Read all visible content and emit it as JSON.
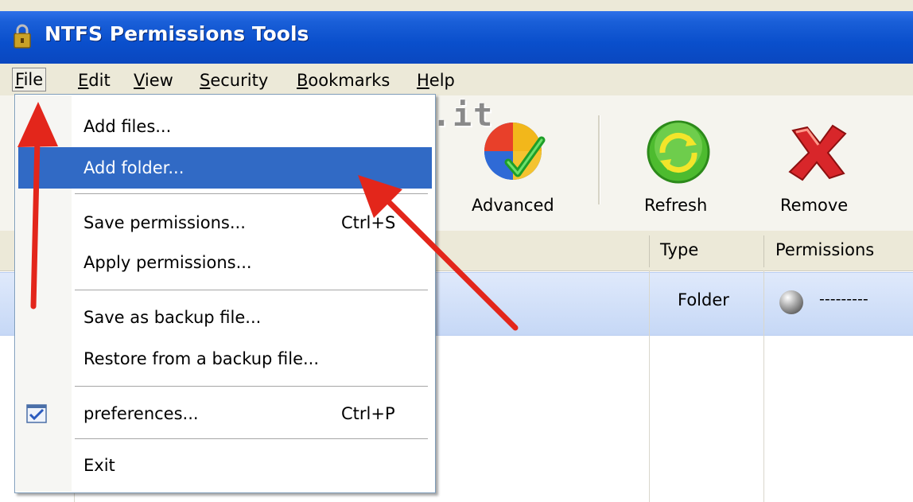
{
  "window": {
    "title": "NTFS Permissions Tools"
  },
  "menubar": {
    "items": [
      {
        "label": "File",
        "mnemonic": "F",
        "rest": "ile"
      },
      {
        "label": "Edit",
        "mnemonic": "E",
        "rest": "dit"
      },
      {
        "label": "View",
        "mnemonic": "V",
        "rest": "iew"
      },
      {
        "label": "Security",
        "mnemonic": "S",
        "rest": "ecurity"
      },
      {
        "label": "Bookmarks",
        "mnemonic": "B",
        "rest": "ookmarks"
      },
      {
        "label": "Help",
        "mnemonic": "H",
        "rest": "elp"
      }
    ]
  },
  "toolbar": {
    "advanced_label": "Advanced",
    "refresh_label": "Refresh",
    "remove_label": "Remove"
  },
  "watermark": "www.wordart.it",
  "file_menu": {
    "add_files": "Add files...",
    "add_folder": "Add folder...",
    "save_permissions": "Save permissions...",
    "save_permissions_shortcut": "Ctrl+S",
    "apply_permissions": "Apply permissions...",
    "save_backup": "Save as backup file...",
    "restore_backup": "Restore from a backup file...",
    "preferences": "preferences...",
    "preferences_shortcut": "Ctrl+P",
    "exit": "Exit"
  },
  "list": {
    "columns": [
      "Type",
      "Permissions"
    ],
    "rows": [
      {
        "type": "Folder",
        "permissions": "---------"
      }
    ]
  },
  "colors": {
    "titlebar": "#0a4fcc",
    "menu_selection": "#316ac5",
    "arrow": "#e3261b"
  }
}
